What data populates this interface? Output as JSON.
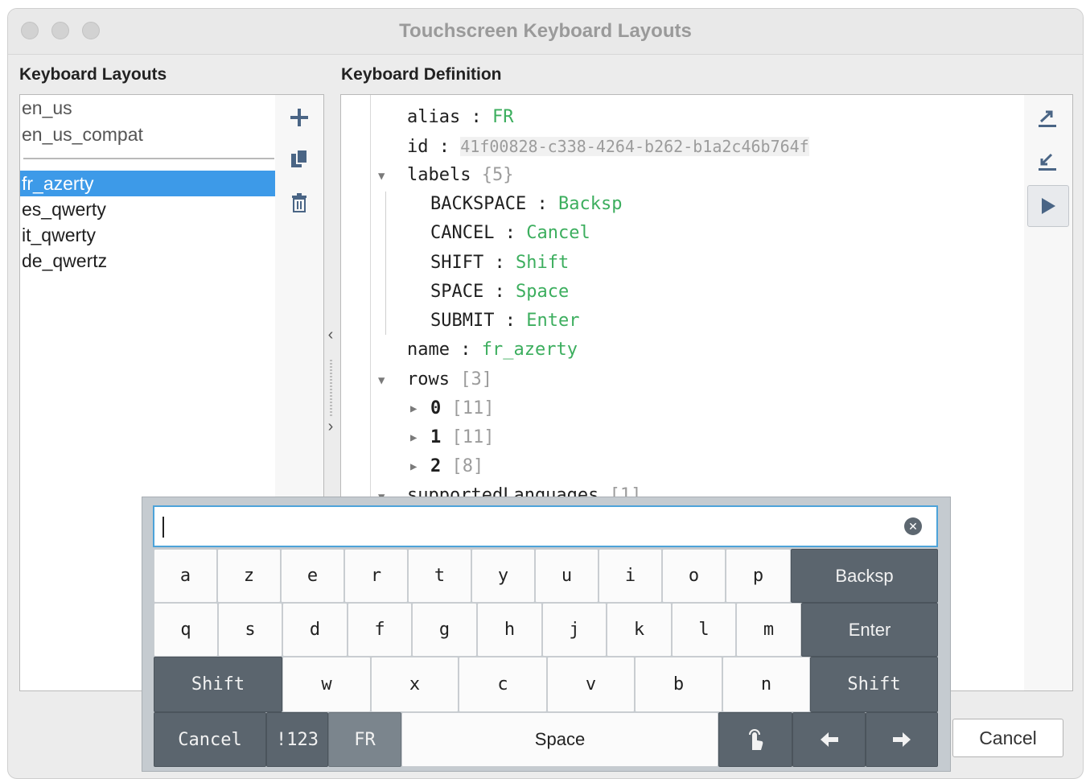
{
  "window": {
    "title": "Touchscreen Keyboard Layouts"
  },
  "layouts_panel": {
    "label": "Keyboard Layouts",
    "items": [
      "en_us",
      "en_us_compat",
      "fr_azerty",
      "es_qwerty",
      "it_qwerty",
      "de_qwertz"
    ],
    "selected": "fr_azerty",
    "tools": [
      "plus-icon",
      "copy-icon",
      "trash-icon"
    ]
  },
  "definition_panel": {
    "label": "Keyboard Definition",
    "alias": {
      "key": "alias",
      "value": "FR"
    },
    "id": {
      "key": "id",
      "value": "41f00828-c338-4264-b262-b1a2c46b764f"
    },
    "labels": {
      "key": "labels",
      "count": "{5}",
      "entries": [
        {
          "key": "BACKSPACE",
          "value": "Backsp"
        },
        {
          "key": "CANCEL",
          "value": "Cancel"
        },
        {
          "key": "SHIFT",
          "value": "Shift"
        },
        {
          "key": "SPACE",
          "value": "Space"
        },
        {
          "key": "SUBMIT",
          "value": "Enter"
        }
      ]
    },
    "name": {
      "key": "name",
      "value": "fr_azerty"
    },
    "rows": {
      "key": "rows",
      "count": "[3]",
      "items": [
        {
          "key": "0",
          "count": "[11]"
        },
        {
          "key": "1",
          "count": "[11]"
        },
        {
          "key": "2",
          "count": "[8]"
        }
      ]
    },
    "supported": {
      "key": "supportedLanguages",
      "count": "[1]"
    },
    "side_buttons": [
      "export-icon",
      "import-icon",
      "preview-play-icon"
    ]
  },
  "footer": {
    "cancel_label": "Cancel"
  },
  "keyboard": {
    "input_value": "",
    "row1": [
      "a",
      "z",
      "e",
      "r",
      "t",
      "y",
      "u",
      "i",
      "o",
      "p"
    ],
    "backspace": "Backsp",
    "row2": [
      "q",
      "s",
      "d",
      "f",
      "g",
      "h",
      "j",
      "k",
      "l",
      "m"
    ],
    "enter": "Enter",
    "shift": "Shift",
    "row3": [
      "w",
      "x",
      "c",
      "v",
      "b",
      "n"
    ],
    "cancel": "Cancel",
    "numeric": "!123",
    "lang": "FR",
    "space": "Space",
    "icons": [
      "touch-hand-icon",
      "arrow-left-icon",
      "arrow-right-icon"
    ]
  }
}
